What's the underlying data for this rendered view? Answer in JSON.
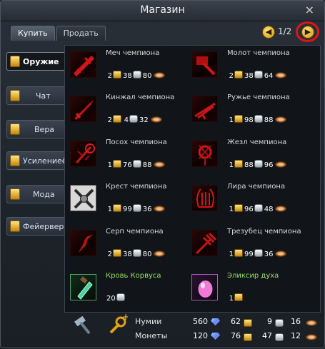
{
  "window": {
    "title": "Магазин",
    "close_glyph": "×"
  },
  "tabs": [
    {
      "label": "Купить",
      "active": true
    },
    {
      "label": "Продать",
      "active": false
    }
  ],
  "pager": {
    "page": "1/2",
    "prev_icon": "arrow-left-icon",
    "next_icon": "arrow-right-icon"
  },
  "categories": [
    {
      "label": "Оружие",
      "active": true,
      "icon": "gold-bag-icon"
    },
    {
      "label": "Чат",
      "active": false,
      "icon": "gold-bag-icon"
    },
    {
      "label": "Вера",
      "active": false,
      "icon": "gold-bag-icon"
    },
    {
      "label": "Усилениеё",
      "active": false,
      "icon": "gold-bag-icon"
    },
    {
      "label": "Мода",
      "active": false,
      "icon": "gold-bag-icon"
    },
    {
      "label": "Фейерверк",
      "active": false,
      "icon": "gold-bag-icon"
    }
  ],
  "items": [
    {
      "name": "Меч чемпиона",
      "gold": "2",
      "silver": "38",
      "copper": "80",
      "icon": "champion-sword-icon"
    },
    {
      "name": "Молот чемпиона",
      "gold": "2",
      "silver": "38",
      "copper": "64",
      "icon": "champion-hammer-icon"
    },
    {
      "name": "Кинжал чемпиона",
      "gold": "2",
      "silver": "4",
      "copper": "32",
      "icon": "champion-dagger-icon"
    },
    {
      "name": "Ружье чемпиона",
      "gold": "1",
      "silver": "98",
      "copper": "88",
      "icon": "champion-rifle-icon"
    },
    {
      "name": "Посох чемпиона",
      "gold": "1",
      "silver": "76",
      "copper": "88",
      "icon": "champion-staff-icon"
    },
    {
      "name": "Жезл чемпиона",
      "gold": "1",
      "silver": "88",
      "copper": "96",
      "icon": "champion-wand-icon"
    },
    {
      "name": "Крест чемпиона",
      "gold": "1",
      "silver": "99",
      "copper": "36",
      "icon": "champion-cross-icon"
    },
    {
      "name": "Лира чемпиона",
      "gold": "1",
      "silver": "96",
      "copper": "48",
      "icon": "champion-lyre-icon"
    },
    {
      "name": "Серп чемпиона",
      "gold": "2",
      "silver": "38",
      "copper": "80",
      "icon": "champion-sickle-icon"
    },
    {
      "name": "Трезубец чемпиона",
      "gold": "1",
      "silver": "99",
      "copper": "36",
      "icon": "champion-trident-icon"
    },
    {
      "name": "Кровь Корвуса",
      "gold": "",
      "silver": "20",
      "copper": "",
      "icon": "corvus-blood-vial-icon"
    },
    {
      "name": "Эликсир духа",
      "gold": "1",
      "silver": "",
      "copper": "",
      "icon": "spirit-elixir-icon"
    }
  ],
  "currency": {
    "numi_label": "Нумии",
    "coins_label": "Монеты",
    "numi": {
      "gems": "560",
      "gold": "62",
      "silver": "9",
      "copper": "16"
    },
    "coins": {
      "gems": "120",
      "gold": "76",
      "silver": "47",
      "copper": "12"
    }
  },
  "colors": {
    "accent_red": "#e11515",
    "gold": "#f2c230",
    "item_green": "#9be06a"
  }
}
